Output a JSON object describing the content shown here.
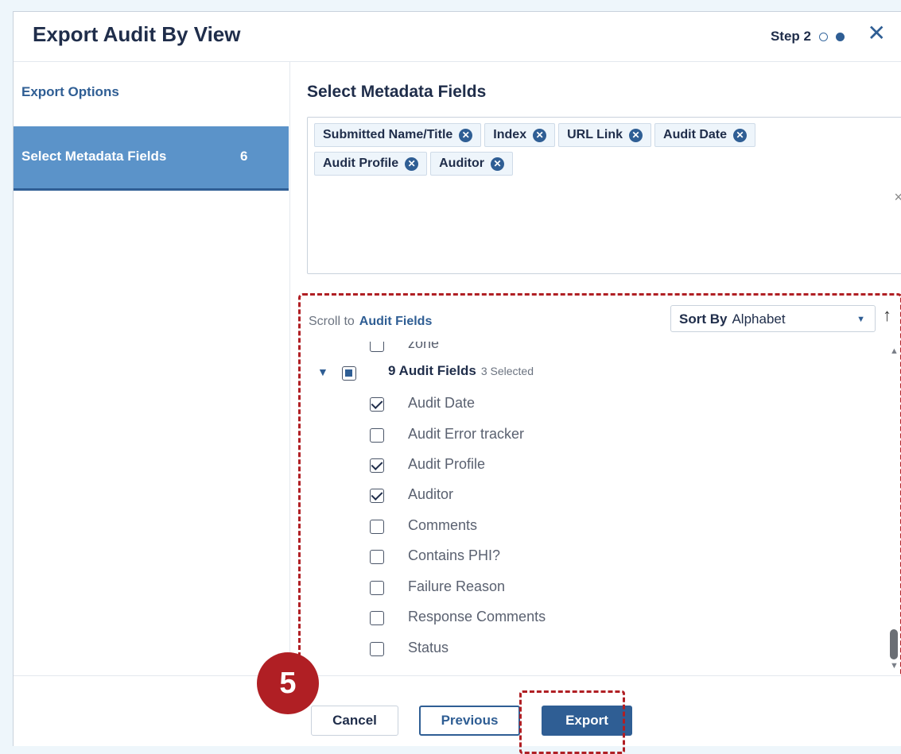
{
  "dialog": {
    "title": "Export Audit By View",
    "step_label": "Step 2",
    "close_symbol": "✕"
  },
  "sidebar": {
    "items": [
      {
        "label": "Export Options"
      },
      {
        "label": "Select Metadata Fields",
        "count": "6"
      }
    ]
  },
  "main": {
    "section_title": "Select Metadata Fields",
    "selected_tags": [
      {
        "label": "Submitted Name/Title"
      },
      {
        "label": "Index"
      },
      {
        "label": "URL Link"
      },
      {
        "label": "Audit Date"
      },
      {
        "label": "Audit Profile"
      },
      {
        "label": "Auditor"
      }
    ],
    "clear_symbol": "×",
    "scroll_to_label": "Scroll to",
    "scroll_to_link": "Audit Fields",
    "sort_by_label": "Sort By",
    "sort_by_value": "Alphabet",
    "sort_direction_symbol": "↑",
    "partial_row_label": "zone",
    "group": {
      "label": "9 Audit Fields",
      "selected_text": "3 Selected"
    },
    "fields": [
      {
        "label": "Audit Date",
        "checked": true
      },
      {
        "label": "Audit Error tracker",
        "checked": false
      },
      {
        "label": "Audit Profile",
        "checked": true
      },
      {
        "label": "Auditor",
        "checked": true
      },
      {
        "label": "Comments",
        "checked": false
      },
      {
        "label": "Contains PHI?",
        "checked": false
      },
      {
        "label": "Failure Reason",
        "checked": false
      },
      {
        "label": "Response Comments",
        "checked": false
      },
      {
        "label": "Status",
        "checked": false
      }
    ]
  },
  "footer": {
    "cancel_label": "Cancel",
    "previous_label": "Previous",
    "export_label": "Export"
  },
  "annotation": {
    "step_badge": "5"
  },
  "colors": {
    "primary": "#2f5e94",
    "sidebar_active": "#5b93c9",
    "annotation_red": "#b01f24"
  }
}
